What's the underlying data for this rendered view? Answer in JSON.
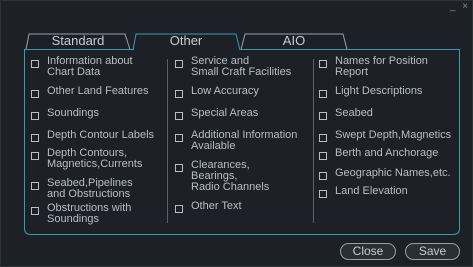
{
  "window": {
    "controls": "_ ×"
  },
  "tabs": [
    {
      "label": "Standard",
      "active": false
    },
    {
      "label": "Other",
      "active": true
    },
    {
      "label": "AIO",
      "active": false
    }
  ],
  "columns": [
    [
      {
        "label": "Information about\nChart Data",
        "checked": false
      },
      {
        "label": "Other Land Features",
        "checked": false
      },
      {
        "label": "Soundings",
        "checked": false
      },
      {
        "label": "Depth Contour Labels",
        "checked": false
      },
      {
        "label": "Depth Contours,\nMagnetics,Currents",
        "checked": false
      },
      {
        "label": "Seabed,Pipelines\nand Obstructions",
        "checked": false
      },
      {
        "label": "Obstructions with\nSoundings",
        "checked": false
      }
    ],
    [
      {
        "label": "Service and\nSmall Craft Facilities",
        "checked": false
      },
      {
        "label": "Low Accuracy",
        "checked": false
      },
      {
        "label": "Special Areas",
        "checked": false
      },
      {
        "label": "Additional Information\nAvailable",
        "checked": false
      },
      {
        "label": "Clearances,\nBearings,\nRadio Channels",
        "checked": false
      },
      {
        "label": "Other Text",
        "checked": false
      }
    ],
    [
      {
        "label": "Names for Position\nReport",
        "checked": false
      },
      {
        "label": "Light Descriptions",
        "checked": false
      },
      {
        "label": "Seabed",
        "checked": false
      },
      {
        "label": "Swept Depth,Magnetics",
        "checked": false
      },
      {
        "label": "Berth and Anchorage",
        "checked": false
      },
      {
        "label": "Geographic Names,etc.",
        "checked": false
      },
      {
        "label": "Land Elevation",
        "checked": false
      }
    ]
  ],
  "buttons": {
    "close": "Close",
    "save": "Save"
  },
  "colors": {
    "accent": "#2f9fa8",
    "background": "#1d2127",
    "text": "#c8ccd0"
  }
}
